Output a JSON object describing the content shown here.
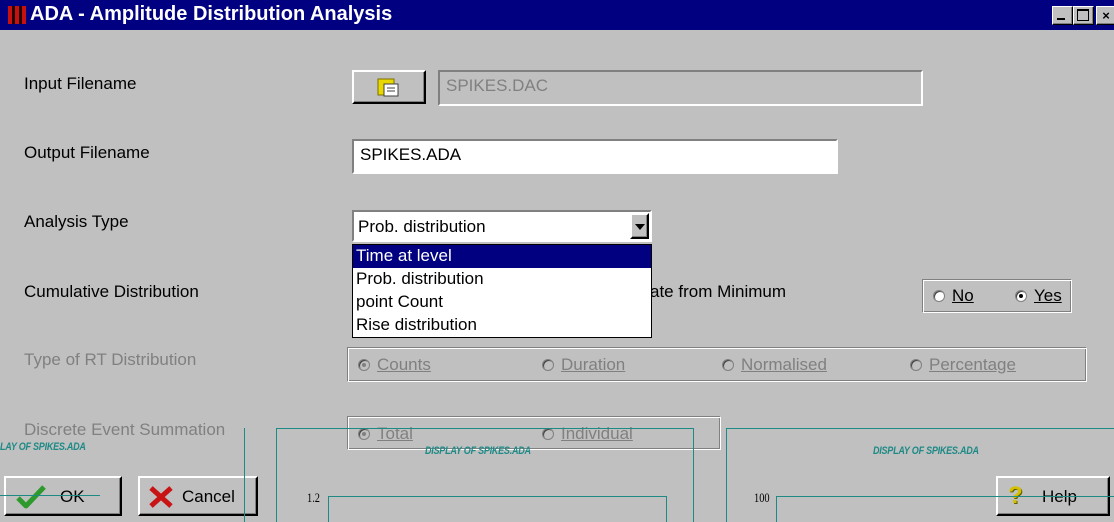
{
  "window": {
    "title": "ADA - Amplitude Distribution Analysis",
    "controls": [
      "minimize",
      "maximize",
      "close"
    ]
  },
  "input_filename": {
    "label": "Input Filename",
    "value": "SPIKES.DAC",
    "browse_icon": "folder-document-icon"
  },
  "output_filename": {
    "label": "Output Filename",
    "value": "SPIKES.ADA"
  },
  "analysis_type": {
    "label": "Analysis Type",
    "selected": "Prob. distribution",
    "options": [
      "Time at level",
      "Prob. distribution",
      "point Count",
      "Rise distribution"
    ],
    "highlighted": "Time at level"
  },
  "cumulative": {
    "label": "Cumulative Distribution",
    "partial_text": "ate from Minimum",
    "no_label": "No",
    "yes_label": "Yes",
    "selected": "Yes"
  },
  "rt_distribution": {
    "label": "Type of RT Distribution",
    "options": [
      "Counts",
      "Duration",
      "Normalised",
      "Percentage"
    ],
    "selected": "Counts"
  },
  "discrete": {
    "label": "Discrete Event Summation",
    "options": [
      "Total",
      "Individual"
    ],
    "selected": "Total"
  },
  "buttons": {
    "ok": "OK",
    "cancel": "Cancel",
    "help": "Help"
  },
  "overlay": {
    "display_text": "DISPLAY OF SPIKES.ADA",
    "left_fragment": "LAY OF SPIKES.ADA",
    "tick_a": "1.2",
    "tick_b": "100"
  },
  "colors": {
    "titlebar": "#000080",
    "face": "#c0c0c0",
    "overlay_teal": "#1e8a86",
    "ok_check": "#2e9a2e",
    "cancel_x": "#c81414",
    "help_q": "#d4c000"
  }
}
